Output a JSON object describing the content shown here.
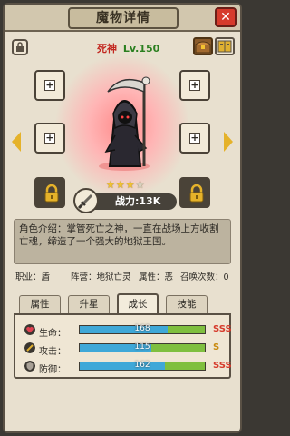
{
  "header": {
    "title": "魔物详情",
    "close_label": "✕"
  },
  "monster": {
    "name": "死神",
    "level": "Lv.150",
    "stars_filled": 3,
    "stars_total": 4,
    "power_label": "战力:13K"
  },
  "description": "角色介绍：掌管死亡之神，一直在战场上方收割亡魂，缔造了一个强大的地狱王国。",
  "info": {
    "job": "职业：盾",
    "camp": "阵营：地狱亡灵",
    "attr": "属性：恶",
    "summon": "召唤次数：0"
  },
  "tabs": [
    {
      "label": "属性",
      "active": false
    },
    {
      "label": "升星",
      "active": false
    },
    {
      "label": "成长",
      "active": true
    },
    {
      "label": "技能",
      "active": false
    }
  ],
  "stats": [
    {
      "label": "生命：",
      "value": "168",
      "fill": 0.7,
      "grade": "SSS",
      "grade_color": "#d63b2c",
      "icon_color": "#d63b4c"
    },
    {
      "label": "攻击：",
      "value": "115",
      "fill": 0.57,
      "grade": "S",
      "grade_color": "#c98a0e",
      "icon_color": "#e0b030"
    },
    {
      "label": "防御：",
      "value": "162",
      "fill": 0.68,
      "grade": "SSS",
      "grade_color": "#d63b2c",
      "icon_color": "#8a8278"
    }
  ],
  "colors": {
    "accent_red": "#d63b2c",
    "bar_blue": "#3fa8d8",
    "bar_green": "#7fbf3f",
    "arrow_gold": "#e5b22a"
  }
}
